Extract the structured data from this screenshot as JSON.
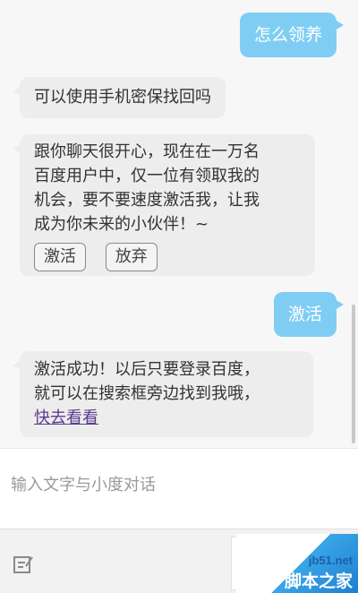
{
  "messages": {
    "user_1": "怎么领养",
    "bot_1": "可以使用手机密保找回吗",
    "bot_2_lines": [
      "跟你聊天很开心，现在在一万名",
      "百度用户中，仅一位有领取我的",
      "机会，要不要速度激活我，让我",
      "成为你未来的小伙伴！~"
    ],
    "bot_2_buttons": [
      "激活",
      "放弃"
    ],
    "user_2": "激活",
    "bot_3_lines": [
      "激活成功！以后只要登录百度，",
      "就可以在搜索框旁边找到我哦，"
    ],
    "bot_3_link": "快去看看"
  },
  "input": {
    "placeholder": "输入文字与小度对话",
    "value": ""
  },
  "bottom": {
    "edit_icon": "edit-icon",
    "send_box_dots": "..."
  },
  "watermark": {
    "site": "jb51.net",
    "name": "脚本之家"
  },
  "colors": {
    "user_bubble": "#7fcdf3",
    "bot_bubble": "#ededed",
    "link": "#5b3b8f",
    "background": "#f7f7f7"
  }
}
